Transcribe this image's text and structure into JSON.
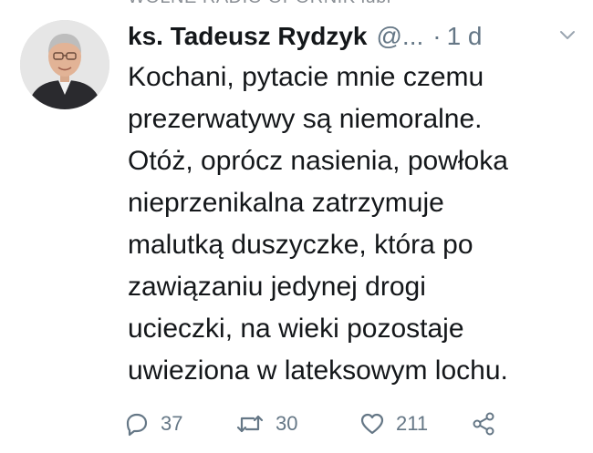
{
  "cropped_header_text": "WOLNE RADIO OPORNIK lubi",
  "tweet": {
    "author_name": "ks. Tadeusz Rydzyk",
    "handle": "@...",
    "separator": "·",
    "time": "1 d",
    "text_lines": [
      "Kochani, pytacie mnie czemu",
      "prezerwatywy są niemoralne.",
      "Otóż, oprócz nasienia, powłoka",
      "nieprzenikalna zatrzymuje",
      "malutką duszyczke, która po",
      "zawiązaniu jedynej drogi",
      "ucieczki, na wieki pozostaje",
      "uwieziona w lateksowym lochu."
    ]
  },
  "actions": {
    "reply_count": "37",
    "retweet_count": "30",
    "like_count": "211"
  },
  "icons": {
    "reply": "reply-icon",
    "retweet": "retweet-icon",
    "like": "heart-icon",
    "share": "share-icon",
    "menu": "chevron-down-icon"
  },
  "colors": {
    "text": "#14171a",
    "secondary": "#657786"
  }
}
